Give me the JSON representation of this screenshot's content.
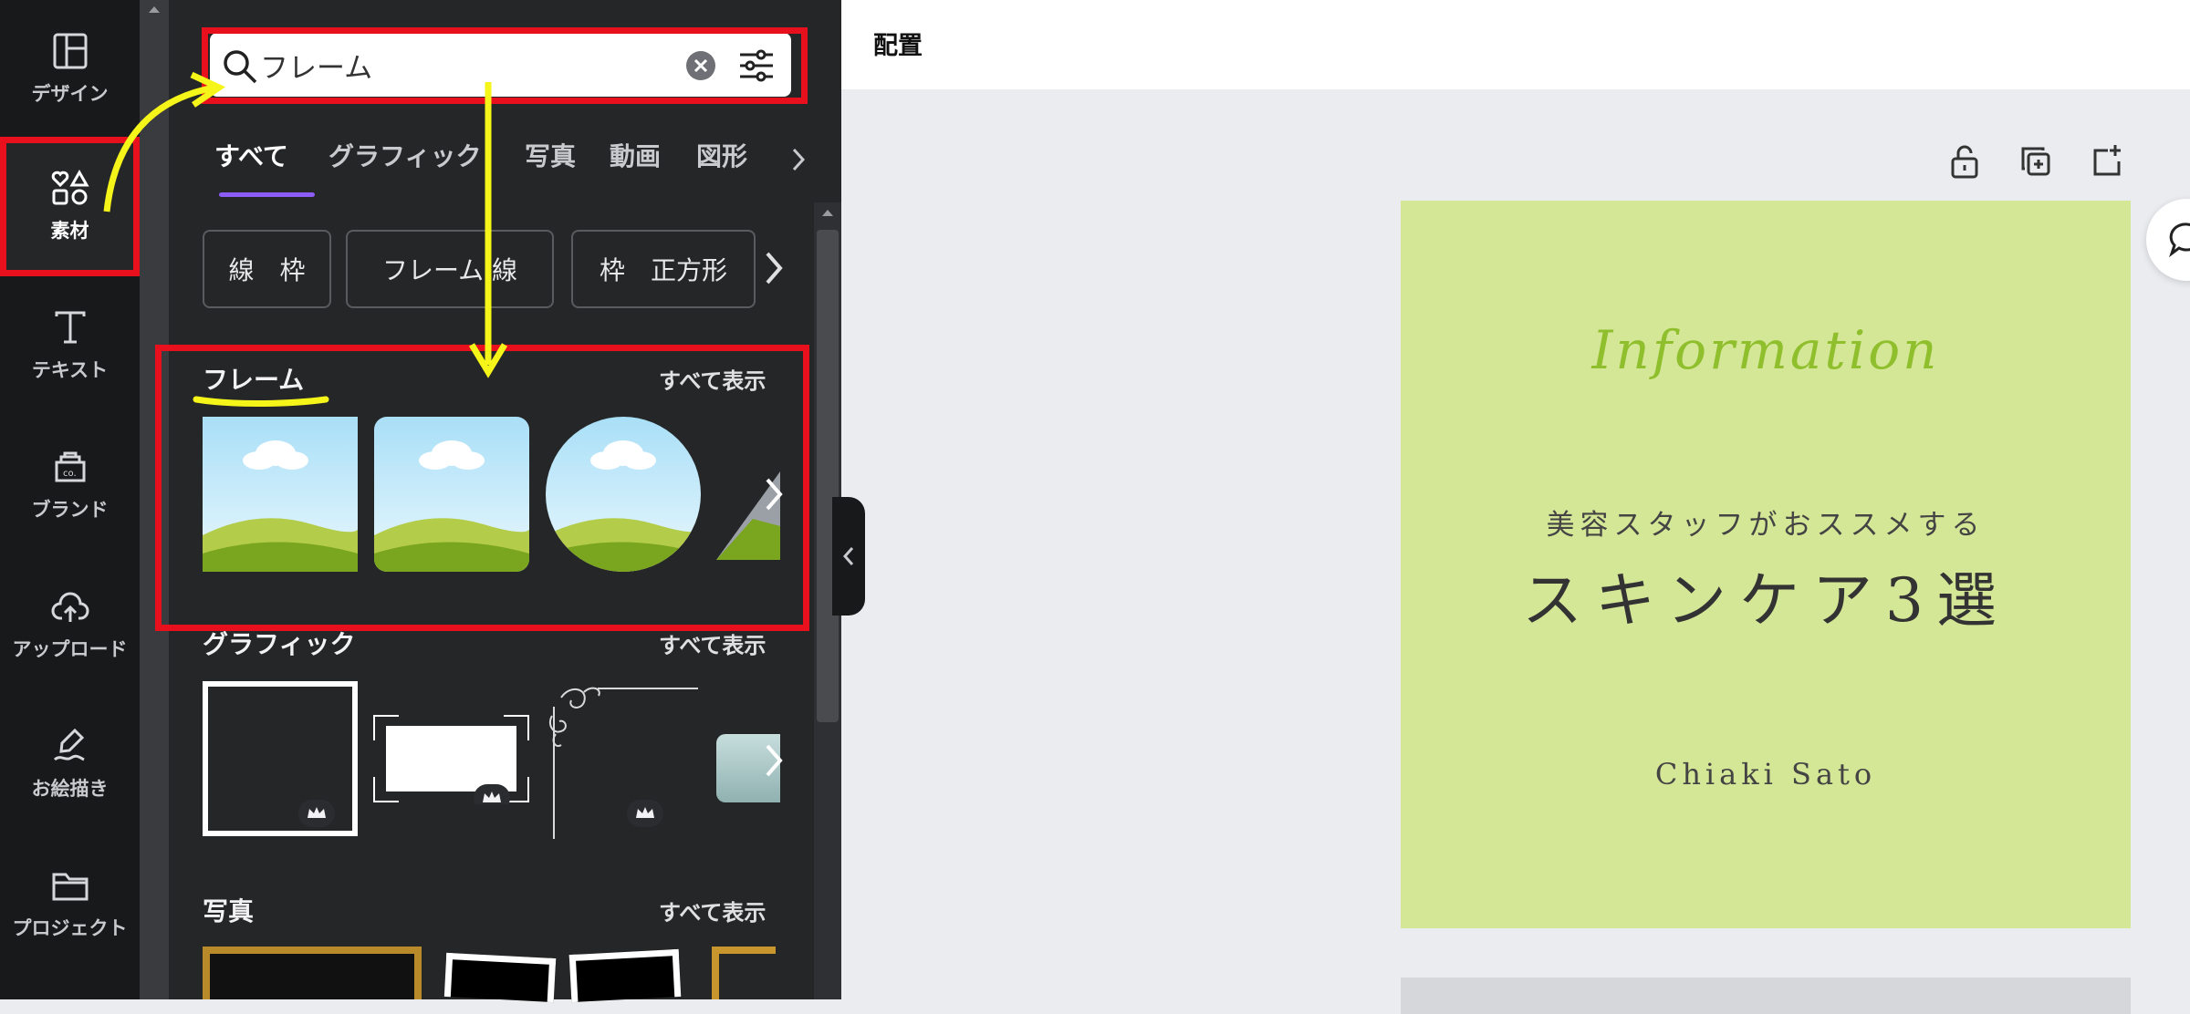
{
  "sidebar": {
    "items": [
      {
        "label": "デザイン",
        "icon": "layout-icon"
      },
      {
        "label": "素材",
        "icon": "elements-icon",
        "active": true
      },
      {
        "label": "テキスト",
        "icon": "text-icon"
      },
      {
        "label": "ブランド",
        "icon": "brand-icon"
      },
      {
        "label": "アップロード",
        "icon": "upload-cloud-icon"
      },
      {
        "label": "お絵描き",
        "icon": "draw-icon"
      },
      {
        "label": "プロジェクト",
        "icon": "folder-icon"
      }
    ]
  },
  "search": {
    "value": "フレーム"
  },
  "tabs": [
    "すべて",
    "グラフィック",
    "写真",
    "動画",
    "図形"
  ],
  "chips": [
    "線　枠",
    "フレーム 線",
    "枠　正方形"
  ],
  "sections": {
    "frames": {
      "title": "フレーム",
      "see_all": "すべて表示"
    },
    "graphics": {
      "title": "グラフィック",
      "see_all": "すべて表示"
    },
    "photos": {
      "title": "写真",
      "see_all": "すべて表示"
    }
  },
  "topbar": {
    "title": "配置"
  },
  "design": {
    "script_title": "Information",
    "subtitle": "美容スタッフがおススメする",
    "main_title": "スキンケア3選",
    "author": "Chiaki Sato"
  },
  "colors": {
    "annotation_red": "#e8101c",
    "annotation_yellow": "#f5f51a",
    "design_bg": "#d4e796",
    "tab_underline": "#8b5cf6"
  }
}
